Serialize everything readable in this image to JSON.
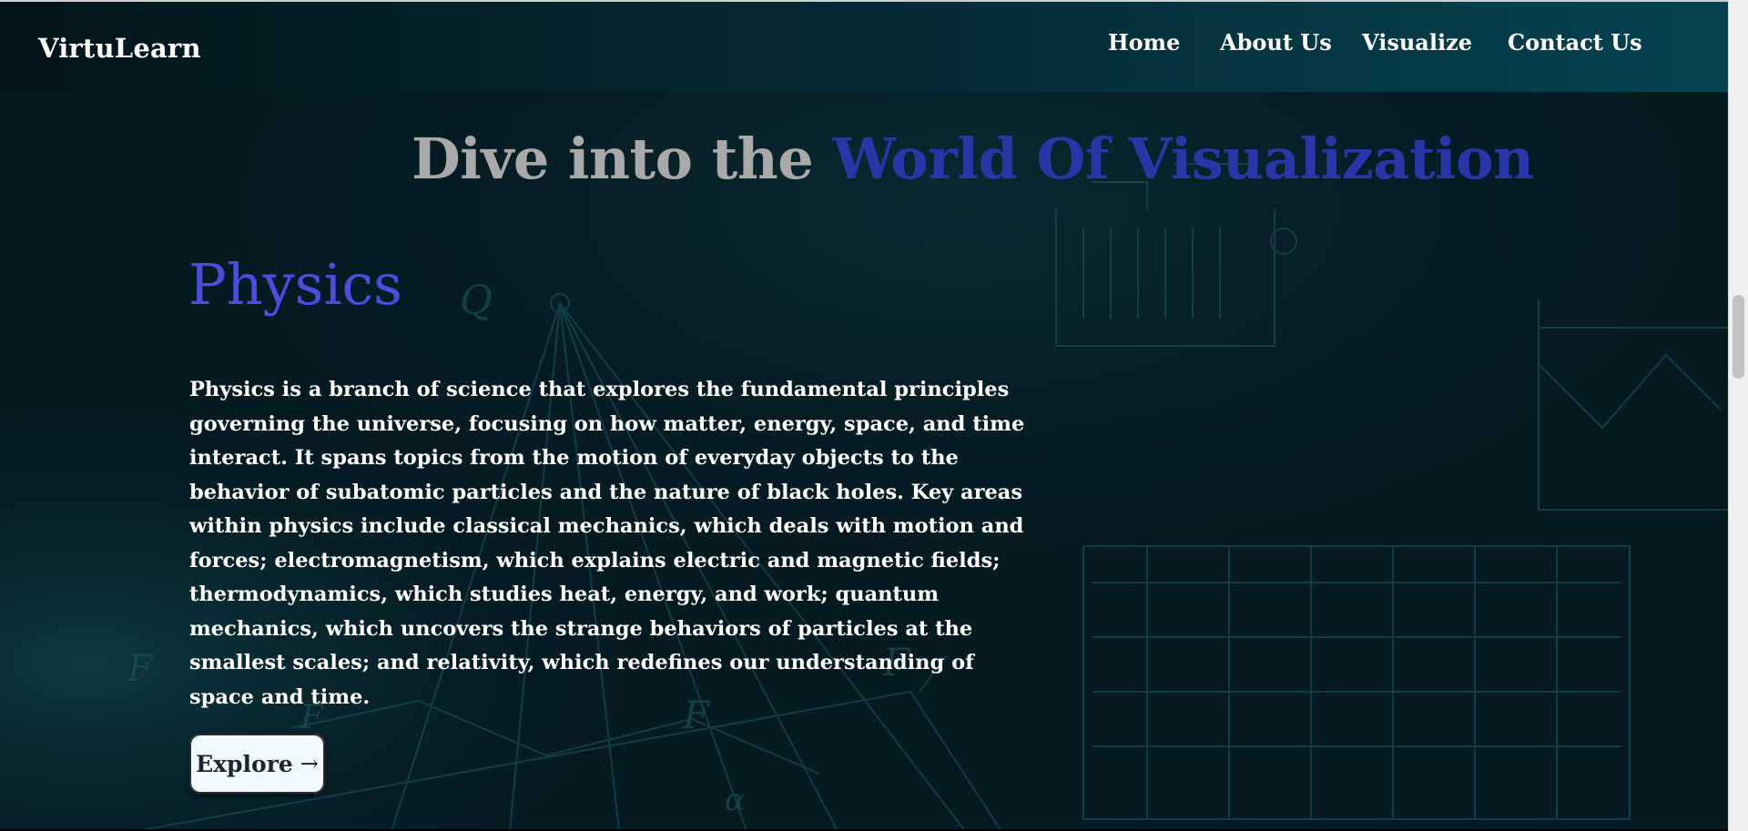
{
  "header": {
    "brand": "VirtuLearn",
    "nav": [
      {
        "label": "Home"
      },
      {
        "label": "About Us"
      },
      {
        "label": "Visualize"
      },
      {
        "label": "Contact Us"
      }
    ]
  },
  "hero": {
    "headline_prefix": "Dive into the",
    "headline_highlight": "World Of Visualization"
  },
  "subject": {
    "title": "Physics",
    "description": "Physics is a branch of science that explores the fundamental principles governing the universe, focusing on how matter, energy, space, and time interact. It spans topics from the motion of everyday objects to the behavior of subatomic particles and the nature of black holes. Key areas within physics include classical mechanics, which deals with motion and forces; electromagnetism, which explains electric and magnetic fields; thermodynamics, which studies heat, energy, and work; quantum mechanics, which uncovers the strange behaviors of particles at the smallest scales; and relativity, which redefines our understanding of space and time.",
    "button_label": "Explore",
    "button_arrow": "→"
  },
  "colors": {
    "page_background": "#061a22",
    "headline_gray": "#a9a9a9",
    "headline_blue": "#2a35a8",
    "subject_title": "#4a4de0",
    "button_background": "#f2f8ff"
  },
  "icons": {
    "button": "right-arrow-icon"
  }
}
